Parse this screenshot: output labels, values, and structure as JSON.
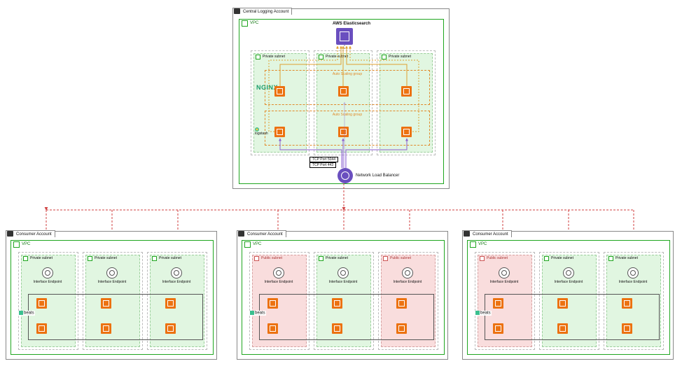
{
  "type": "aws-architecture-diagram",
  "central": {
    "account_label": "Central Logging Account",
    "vpc_label": "VPC",
    "elasticsearch_label": "AWS Elasticsearch",
    "nlb_label": "Network Load Balancer",
    "port1_label": "TCP Port 5044",
    "port2_label": "TCP Port 443",
    "asg_label": "Auto Scaling group",
    "nginx_label": "NGINX",
    "logstash_label": "logstash",
    "subnets": [
      {
        "name": "Private subnet"
      },
      {
        "name": "Private subnet"
      },
      {
        "name": "Private subnet"
      }
    ],
    "autoscaling_groups": [
      {
        "name": "Auto Scaling group",
        "service": "NGINX",
        "instances_per_az": 1,
        "azs": 3
      },
      {
        "name": "Auto Scaling group",
        "service": "logstash",
        "instances_per_az": 1,
        "azs": 3
      }
    ]
  },
  "consumers": [
    {
      "account_label": "Consumer Account",
      "vpc_label": "VPC",
      "beats_label": "beats",
      "endpoint_label": "Interface Endpoint",
      "subnets": [
        {
          "type": "private",
          "label": "Private subnet"
        },
        {
          "type": "private",
          "label": "Private subnet"
        },
        {
          "type": "private",
          "label": "Private subnet"
        }
      ]
    },
    {
      "account_label": "Consumer Account",
      "vpc_label": "VPC",
      "beats_label": "beats",
      "endpoint_label": "Interface Endpoint",
      "subnets": [
        {
          "type": "public",
          "label": "Public subnet"
        },
        {
          "type": "private",
          "label": "Private subnet"
        },
        {
          "type": "public",
          "label": "Public subnet"
        }
      ]
    },
    {
      "account_label": "Consumer Account",
      "vpc_label": "VPC",
      "beats_label": "beats",
      "endpoint_label": "Interface Endpoint",
      "subnets": [
        {
          "type": "public",
          "label": "Public subnet"
        },
        {
          "type": "private",
          "label": "Private subnet"
        },
        {
          "type": "private",
          "label": "Private subnet"
        }
      ]
    }
  ],
  "connections": {
    "consumer_to_nlb": "VPC Interface Endpoint (PrivateLink) → NLB",
    "nlb_listeners": [
      "TCP 443 → NGINX ASG",
      "TCP 5044 → logstash ASG"
    ],
    "asg_to_es": "NGINX & logstash instances → AWS Elasticsearch"
  }
}
